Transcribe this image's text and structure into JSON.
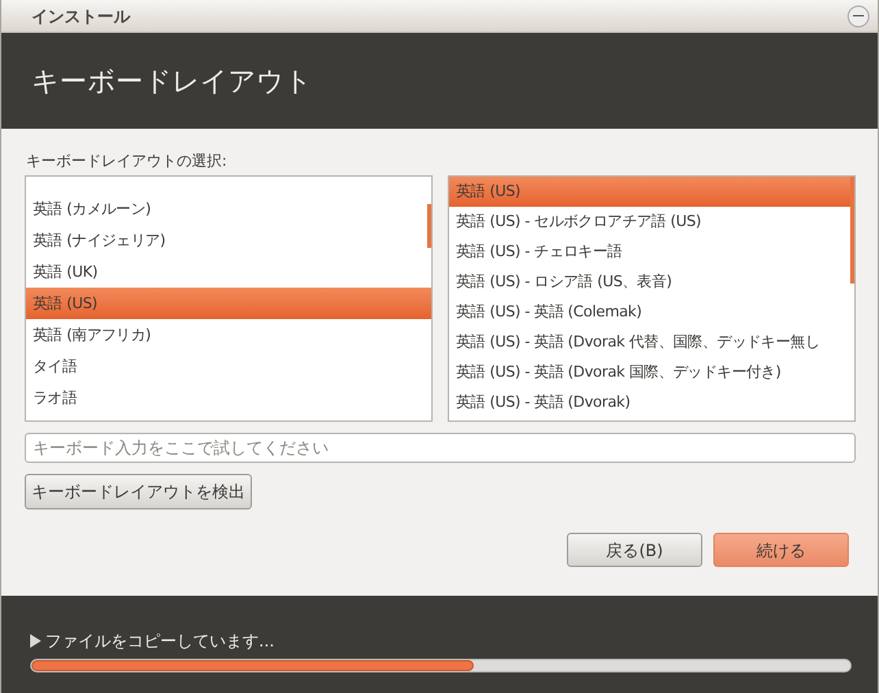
{
  "window": {
    "title": "インストール"
  },
  "header": {
    "title": "キーボードレイアウト"
  },
  "layout_label": "キーボードレイアウトの選択:",
  "layouts": [
    {
      "label": "英語 (カメルーン)",
      "selected": false
    },
    {
      "label": "英語 (ナイジェリア)",
      "selected": false
    },
    {
      "label": "英語 (UK)",
      "selected": false
    },
    {
      "label": "英語 (US)",
      "selected": true
    },
    {
      "label": "英語 (南アフリカ)",
      "selected": false
    },
    {
      "label": "タイ語",
      "selected": false
    },
    {
      "label": "ラオ語",
      "selected": false
    }
  ],
  "variants": [
    {
      "label": "英語 (US)",
      "selected": true
    },
    {
      "label": "英語 (US) - セルボクロアチア語 (US)",
      "selected": false
    },
    {
      "label": "英語 (US) - チェロキー語",
      "selected": false
    },
    {
      "label": "英語 (US) - ロシア語 (US、表音)",
      "selected": false
    },
    {
      "label": "英語 (US) - 英語 (Colemak)",
      "selected": false
    },
    {
      "label": "英語 (US) - 英語 (Dvorak 代替、国際、デッドキー無し",
      "selected": false
    },
    {
      "label": "英語 (US) - 英語 (Dvorak 国際、デッドキー付き)",
      "selected": false
    },
    {
      "label": "英語 (US) - 英語 (Dvorak)",
      "selected": false
    }
  ],
  "test_field": {
    "placeholder": "キーボード入力をここで試してください"
  },
  "detect_button": "キーボードレイアウトを検出",
  "buttons": [
    {
      "label": "戻る(B)",
      "kind": "secondary"
    },
    {
      "label": "続ける",
      "kind": "primary"
    }
  ],
  "progress": {
    "label": "ファイルをコピーしています...",
    "level": 0.54
  }
}
